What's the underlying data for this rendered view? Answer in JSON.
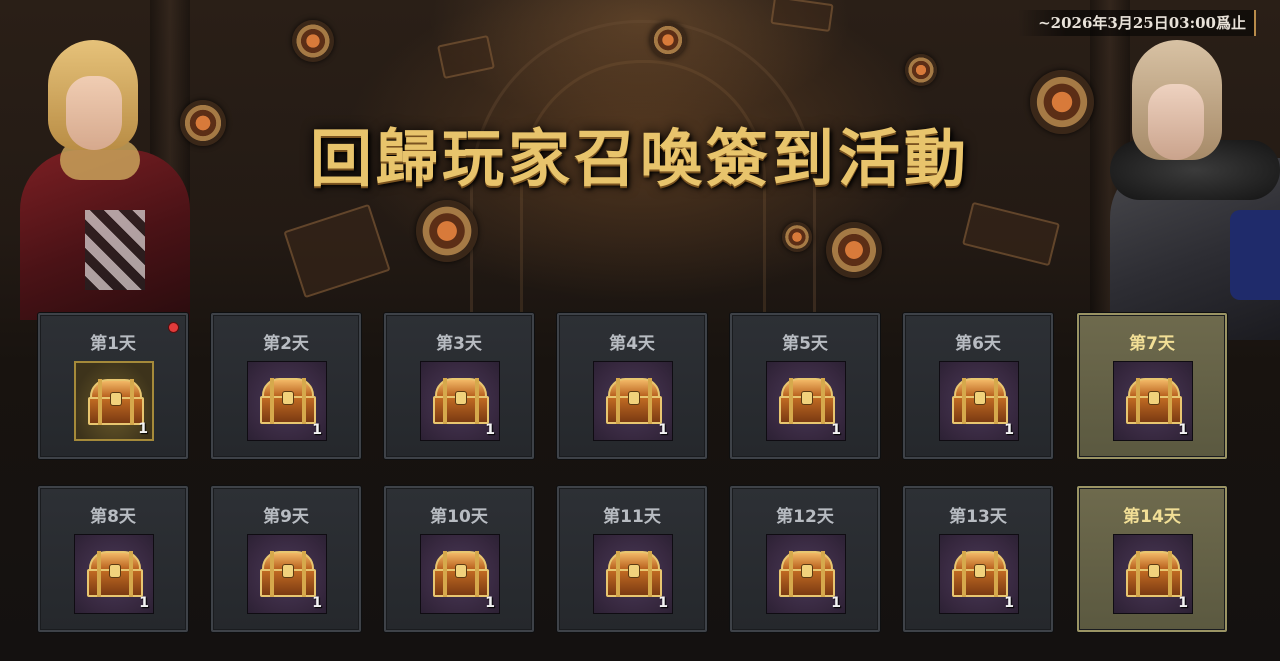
{
  "event": {
    "title": "回歸玩家召喚簽到活動",
    "end_date": "~2026年3月25日03:00爲止"
  },
  "days": [
    {
      "label": "第1天",
      "qty": "1",
      "highlight": false,
      "active": true,
      "notify": true
    },
    {
      "label": "第2天",
      "qty": "1",
      "highlight": false,
      "active": false,
      "notify": false
    },
    {
      "label": "第3天",
      "qty": "1",
      "highlight": false,
      "active": false,
      "notify": false
    },
    {
      "label": "第4天",
      "qty": "1",
      "highlight": false,
      "active": false,
      "notify": false
    },
    {
      "label": "第5天",
      "qty": "1",
      "highlight": false,
      "active": false,
      "notify": false
    },
    {
      "label": "第6天",
      "qty": "1",
      "highlight": false,
      "active": false,
      "notify": false
    },
    {
      "label": "第7天",
      "qty": "1",
      "highlight": true,
      "active": false,
      "notify": false
    },
    {
      "label": "第8天",
      "qty": "1",
      "highlight": false,
      "active": false,
      "notify": false
    },
    {
      "label": "第9天",
      "qty": "1",
      "highlight": false,
      "active": false,
      "notify": false
    },
    {
      "label": "第10天",
      "qty": "1",
      "highlight": false,
      "active": false,
      "notify": false
    },
    {
      "label": "第11天",
      "qty": "1",
      "highlight": false,
      "active": false,
      "notify": false
    },
    {
      "label": "第12天",
      "qty": "1",
      "highlight": false,
      "active": false,
      "notify": false
    },
    {
      "label": "第13天",
      "qty": "1",
      "highlight": false,
      "active": false,
      "notify": false
    },
    {
      "label": "第14天",
      "qty": "1",
      "highlight": true,
      "active": false,
      "notify": false
    }
  ],
  "reward_icon": "treasure-chest-icon",
  "colors": {
    "title_gold": "#e8c46c",
    "cell_normal": "#2d3035",
    "cell_gold": "#6e6a4d",
    "notify_red": "#e23b3b"
  }
}
